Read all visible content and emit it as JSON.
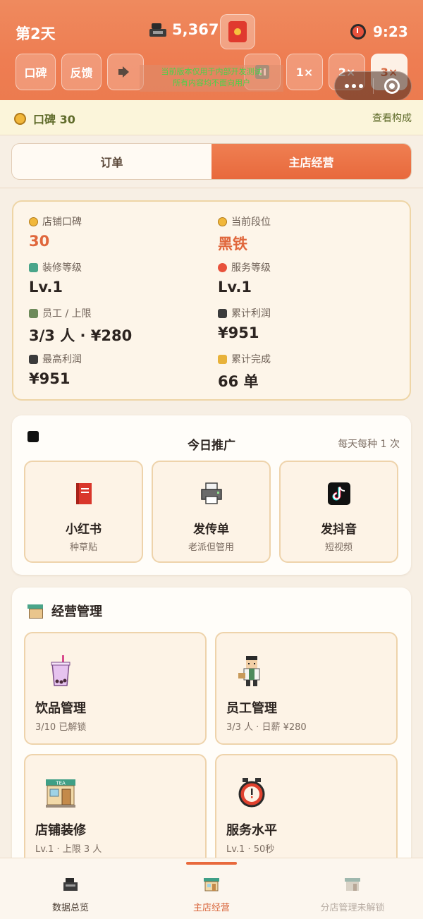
{
  "header": {
    "day": "第2天",
    "money": "5,367",
    "time": "9:23",
    "buttons": {
      "reputation": "口碑",
      "feedback": "反馈",
      "speed_1x": "1×",
      "speed_2x": "2×",
      "speed_3x": "3×"
    },
    "active_speed": "3×",
    "banner_line1": "当前版本仅用于内部开发测试",
    "banner_line2": "所有内容均不面向用户",
    "colors": {
      "header_bg": "#ee7d52",
      "accent": "#e8693c",
      "banner_text": "#4ad24a"
    }
  },
  "reputation_strip": {
    "label": "口碑 30",
    "link": "查看构成"
  },
  "tabs": [
    {
      "label": "订单",
      "active": false
    },
    {
      "label": "主店经营",
      "active": true
    }
  ],
  "stats": {
    "store_reputation": {
      "label": "店铺口碑",
      "value": "30",
      "icon": "coin-icon"
    },
    "current_rank": {
      "label": "当前段位",
      "value": "黑铁",
      "icon": "coin-icon"
    },
    "decor_level": {
      "label": "装修等级",
      "value": "Lv.1",
      "icon": "shop-icon"
    },
    "service_level": {
      "label": "服务等级",
      "value": "Lv.1",
      "icon": "alarm-clock-icon"
    },
    "staff": {
      "label": "员工 / 上限",
      "value": "3/3 人 · ¥280",
      "icon": "staff-icon"
    },
    "total_profit": {
      "label": "累计利润",
      "value": "¥951",
      "icon": "cash-register-icon"
    },
    "max_profit": {
      "label": "最高利润",
      "value": "¥951",
      "icon": "cash-register-icon"
    },
    "total_completed": {
      "label": "累计完成",
      "value": "66 单",
      "icon": "lock-icon"
    }
  },
  "promotion": {
    "title": "今日推广",
    "note": "每天每种 1 次",
    "items": [
      {
        "name": "小红书",
        "sub": "种草贴",
        "icon": "red-book-icon"
      },
      {
        "name": "发传单",
        "sub": "老派但管用",
        "icon": "printer-icon"
      },
      {
        "name": "发抖音",
        "sub": "短视频",
        "icon": "tiktok-icon"
      }
    ]
  },
  "management": {
    "title": "经营管理",
    "items": [
      {
        "name": "饮品管理",
        "sub": "3/10 已解锁",
        "icon": "bubble-tea-icon"
      },
      {
        "name": "员工管理",
        "sub": "3/3 人 · 日薪 ¥280",
        "icon": "staff-icon"
      },
      {
        "name": "店铺装修",
        "sub": "Lv.1 · 上限 3 人",
        "icon": "tea-shop-icon",
        "sign": "TEA"
      },
      {
        "name": "服务水平",
        "sub": "Lv.1 · 50秒",
        "icon": "alarm-clock-icon"
      }
    ]
  },
  "bottom_nav": [
    {
      "label": "数据总览",
      "icon": "cash-register-icon",
      "state": "normal"
    },
    {
      "label": "主店经营",
      "icon": "shop-icon",
      "state": "active"
    },
    {
      "label": "分店管理未解锁",
      "icon": "locked-shop-icon",
      "state": "disabled"
    }
  ]
}
